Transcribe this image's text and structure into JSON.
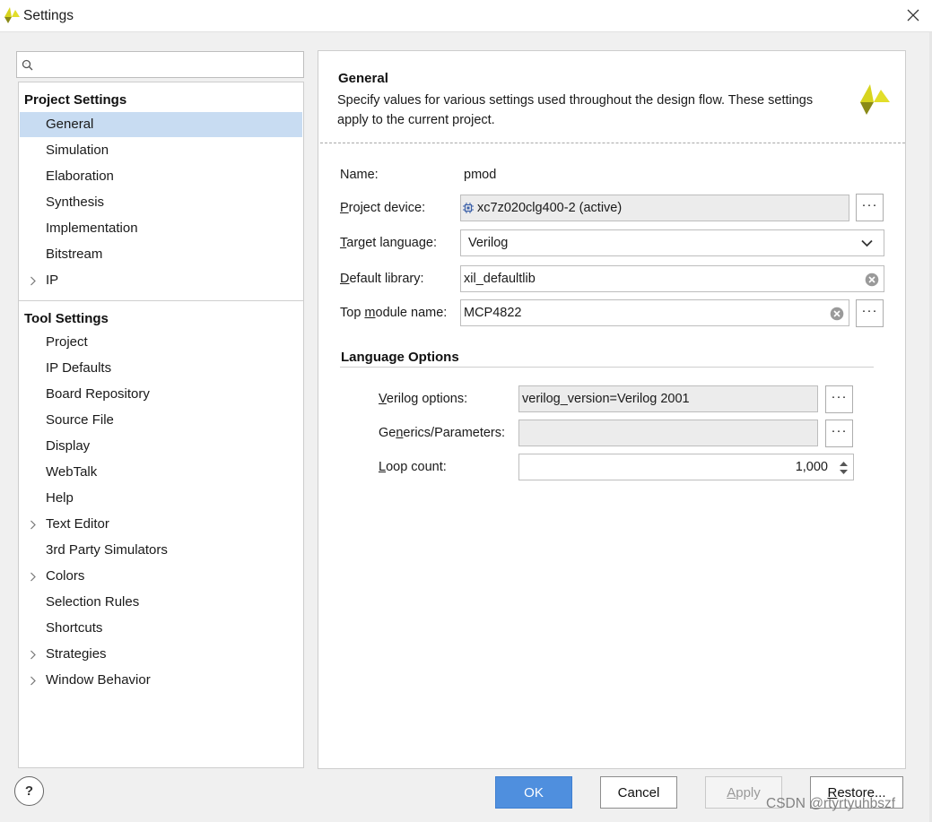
{
  "window": {
    "title": "Settings",
    "close_glyph": "✕"
  },
  "search": {
    "placeholder": "",
    "icon": "search-icon"
  },
  "tree": {
    "sections": [
      {
        "title": "Project Settings",
        "items": [
          {
            "label": "General",
            "selected": true,
            "expandable": false
          },
          {
            "label": "Simulation",
            "expandable": false
          },
          {
            "label": "Elaboration",
            "expandable": false
          },
          {
            "label": "Synthesis",
            "expandable": false
          },
          {
            "label": "Implementation",
            "expandable": false
          },
          {
            "label": "Bitstream",
            "expandable": false
          },
          {
            "label": "IP",
            "expandable": true
          }
        ]
      },
      {
        "title": "Tool Settings",
        "items": [
          {
            "label": "Project",
            "expandable": false
          },
          {
            "label": "IP Defaults",
            "expandable": false
          },
          {
            "label": "Board Repository",
            "expandable": false
          },
          {
            "label": "Source File",
            "expandable": false
          },
          {
            "label": "Display",
            "expandable": false
          },
          {
            "label": "WebTalk",
            "expandable": false
          },
          {
            "label": "Help",
            "expandable": false
          },
          {
            "label": "Text Editor",
            "expandable": true
          },
          {
            "label": "3rd Party Simulators",
            "expandable": false
          },
          {
            "label": "Colors",
            "expandable": true
          },
          {
            "label": "Selection Rules",
            "expandable": false
          },
          {
            "label": "Shortcuts",
            "expandable": false
          },
          {
            "label": "Strategies",
            "expandable": true
          },
          {
            "label": "Window Behavior",
            "expandable": true
          }
        ]
      }
    ]
  },
  "panel": {
    "title": "General",
    "description": "Specify values for various settings used throughout the design flow. These settings apply to the current project.",
    "name_label": "Name:",
    "name_value": "pmod",
    "device_label": {
      "key": "P",
      "rest": "roject device:"
    },
    "device_value": "xc7z020clg400-2 (active)",
    "target_label": {
      "key": "T",
      "rest": "arget language:"
    },
    "target_value": "Verilog",
    "library_label": {
      "key": "D",
      "rest": "efault library:"
    },
    "library_value": "xil_defaultlib",
    "top_label": {
      "pre": "Top ",
      "key": "m",
      "rest": "odule name:"
    },
    "top_value": "MCP4822",
    "language_options": {
      "heading": "Language Options",
      "verilog_label": {
        "key": "V",
        "rest": "erilog options:"
      },
      "verilog_value": "verilog_version=Verilog 2001",
      "generics_label": {
        "pre": "Ge",
        "key": "n",
        "rest": "erics/Parameters:"
      },
      "generics_value": "",
      "loop_label": {
        "key": "L",
        "rest": "oop count:"
      },
      "loop_value": "1,000"
    },
    "ellipsis": "···"
  },
  "buttons": {
    "help": "?",
    "ok": "OK",
    "cancel": "Cancel",
    "apply": {
      "key": "A",
      "rest": "pply"
    },
    "restore": {
      "key": "R",
      "rest": "estore..."
    }
  },
  "watermark": "CSDN @rtyrtyuhbszf",
  "colors": {
    "accent": "#4f8fde",
    "selection": "#c8dcf2",
    "logo_yellow": "#d7d41e",
    "logo_olive": "#8a8a17"
  }
}
